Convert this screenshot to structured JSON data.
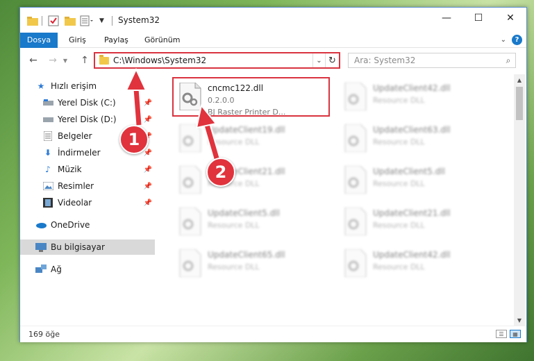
{
  "window": {
    "title": "System32",
    "minimize": "—",
    "maximize": "☐",
    "close": "✕"
  },
  "ribbon": {
    "tabs": [
      "Dosya",
      "Giriş",
      "Paylaş",
      "Görünüm"
    ],
    "help": "?"
  },
  "address": {
    "path": "C:\\Windows\\System32"
  },
  "search": {
    "placeholder": "Ara: System32"
  },
  "nav": {
    "items": [
      {
        "label": "Hızlı erişim",
        "icon": "star-icon"
      },
      {
        "label": "Yerel Disk (C:)",
        "icon": "drive-icon"
      },
      {
        "label": "Yerel Disk (D:)",
        "icon": "drive-icon"
      },
      {
        "label": "Belgeler",
        "icon": "documents-icon"
      },
      {
        "label": "İndirmeler",
        "icon": "download-icon"
      },
      {
        "label": "Müzik",
        "icon": "music-icon"
      },
      {
        "label": "Resimler",
        "icon": "pictures-icon"
      },
      {
        "label": "Videolar",
        "icon": "videos-icon"
      },
      {
        "label": "OneDrive",
        "icon": "cloud-icon"
      },
      {
        "label": "Bu bilgisayar",
        "icon": "computer-icon"
      },
      {
        "label": "Ağ",
        "icon": "network-icon"
      }
    ]
  },
  "files": [
    {
      "name": "cncmc122.dll",
      "version": "0.2.0.0",
      "desc": "BJ Raster Printer D..."
    },
    {
      "name": "UpdateClient42.dll",
      "desc": "Resource DLL"
    },
    {
      "name": "UpdateClient19.dll",
      "desc": "Resource DLL"
    },
    {
      "name": "UpdateClient63.dll",
      "desc": "Resource DLL"
    },
    {
      "name": "UpdateClient21.dll",
      "desc": "Resource DLL"
    },
    {
      "name": "UpdateClient5.dll",
      "desc": "Resource DLL"
    },
    {
      "name": "UpdateClient5.dll",
      "desc": "Resource DLL"
    },
    {
      "name": "UpdateClient21.dll",
      "desc": "Resource DLL"
    },
    {
      "name": "UpdateClient65.dll",
      "desc": "Resource DLL"
    },
    {
      "name": "UpdateClient42.dll",
      "desc": "Resource DLL"
    }
  ],
  "status": {
    "count": "169 öğe"
  },
  "annotations": {
    "step1": "1",
    "step2": "2",
    "color": "#e0333d"
  }
}
